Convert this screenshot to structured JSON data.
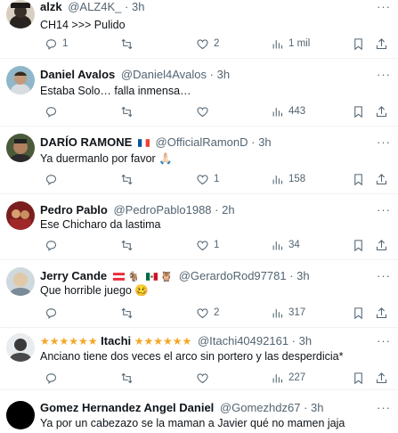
{
  "tweets": [
    {
      "name": "alzk",
      "handle": "@ALZ4K_",
      "time": "3h",
      "text": "CH14 >>> Pulido",
      "replies": "1",
      "reposts": "",
      "likes": "2",
      "views": "1 mil"
    },
    {
      "name": "Daniel Avalos",
      "handle": "@Daniel4Avalos",
      "time": "3h",
      "text": "Estaba Solo… falla inmensa…",
      "replies": "",
      "reposts": "",
      "likes": "",
      "views": "443"
    },
    {
      "name": "DARÍO RAMONE",
      "handle": "@OfficialRamonD",
      "time": "3h",
      "text": "Ya duermanlo por favor 🙏🏻",
      "replies": "",
      "reposts": "",
      "likes": "1",
      "views": "158"
    },
    {
      "name": "Pedro Pablo",
      "handle": "@PedroPablo1988",
      "time": "2h",
      "text": "Ese Chicharo da lastima",
      "replies": "",
      "reposts": "",
      "likes": "1",
      "views": "34"
    },
    {
      "name": "Jerry Cande",
      "handle": "@GerardoRod97781",
      "time": "3h",
      "text": "Que horrible juego 🥴",
      "replies": "",
      "reposts": "",
      "likes": "2",
      "views": "317"
    },
    {
      "name": "Itachi",
      "handle": "@Itachi40492161",
      "time": "3h",
      "stars": "★★★★★★",
      "text": "Anciano tiene dos veces el arco sin portero y las desperdicia*",
      "replies": "",
      "reposts": "",
      "likes": "",
      "views": "227"
    },
    {
      "name": "Gomez Hernandez Angel Daniel",
      "handle": "@Gomezhdz67",
      "time": "3h",
      "text": "Ya por un cabezazo se la maman a Javier qué no mamen jaja"
    }
  ],
  "more_label": "···",
  "dot": "·",
  "colors": {
    "muted": "#536471",
    "text": "#0f1419",
    "divider": "#eff3f4"
  }
}
